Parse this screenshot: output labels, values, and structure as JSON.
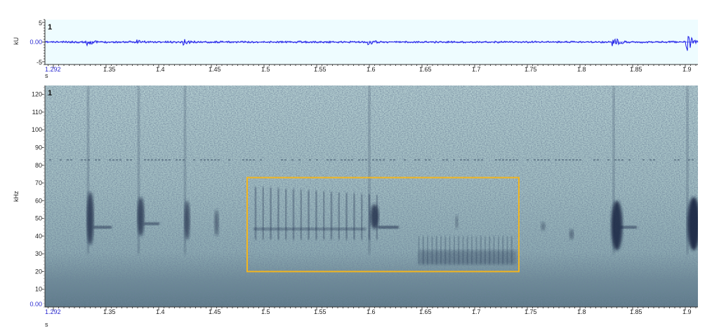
{
  "waveform": {
    "channel": "1",
    "y_axis_label": "kU",
    "y_ticks": [
      "5",
      "0.00",
      "-5"
    ],
    "x_start_label": "1.292",
    "x_tick_labels": [
      "1.35",
      "1.4",
      "1.45",
      "1.5",
      "1.55",
      "1.6",
      "1.65",
      "1.7",
      "1.75",
      "1.8",
      "1.85",
      "1.9"
    ],
    "x_unit": "s",
    "colors": {
      "background": "#eefcff",
      "trace": "#1a1ae6",
      "zero_line": "#6b6bff"
    }
  },
  "spectrogram": {
    "channel": "1",
    "y_axis_label": "kHz",
    "y_ticks": [
      "120",
      "110",
      "100",
      "90",
      "80",
      "70",
      "60",
      "50",
      "40",
      "30",
      "20",
      "10"
    ],
    "y_zero_label": "0.00",
    "x_start_label": "1.292",
    "x_tick_labels": [
      "1.35",
      "1.4",
      "1.45",
      "1.5",
      "1.55",
      "1.6",
      "1.65",
      "1.7",
      "1.75",
      "1.8",
      "1.85",
      "1.9"
    ],
    "x_unit": "s",
    "colors": {
      "background": "#a7c3c6",
      "noise": "#c9dee0",
      "call": "#223050",
      "selection": "#f2b51e"
    }
  },
  "selection": {
    "time_start_s": 1.484,
    "time_end_s": 1.742,
    "freq_low_khz": 20,
    "freq_high_khz": 73
  }
}
